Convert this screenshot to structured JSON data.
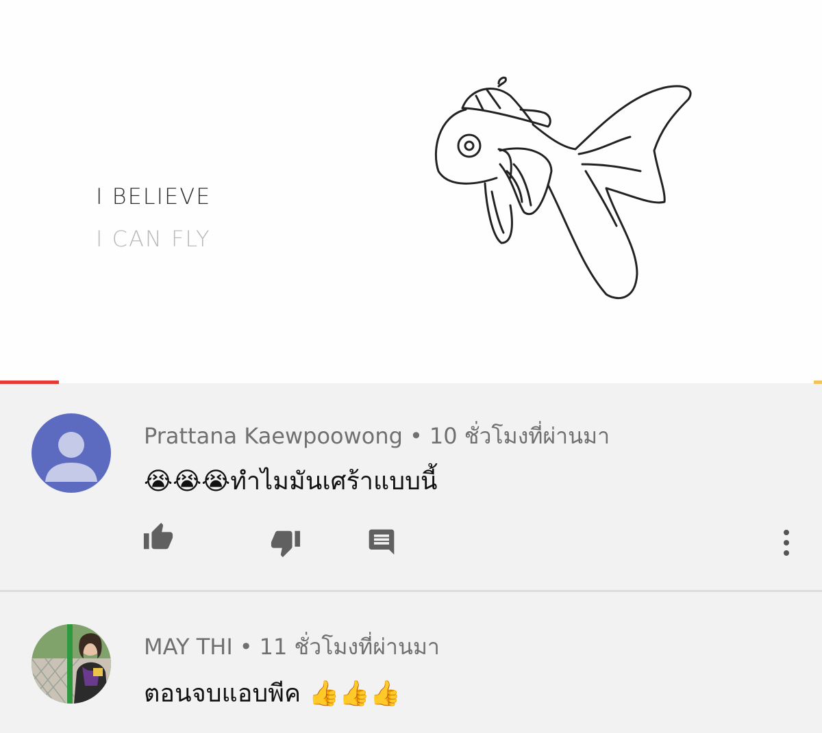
{
  "video": {
    "line1": "I BELIEVE",
    "line2": "I CAN FLY",
    "progress_fraction": 0.072
  },
  "comments": [
    {
      "author": "Prattana Kaewpoowong",
      "time": "10 ชั่วโมงที่ผ่านมา",
      "text": "😭😭😭ทำไมมันเศร้าแบบนี้"
    },
    {
      "author": "MAY THI",
      "time": "11 ชั่วโมงที่ผ่านมา",
      "text": "ตอนจบแอบพีค 👍👍👍"
    }
  ],
  "separator": "•",
  "colors": {
    "accent": "#e53935",
    "default_avatar": "#5c6bc0",
    "meta_text": "#707070"
  }
}
